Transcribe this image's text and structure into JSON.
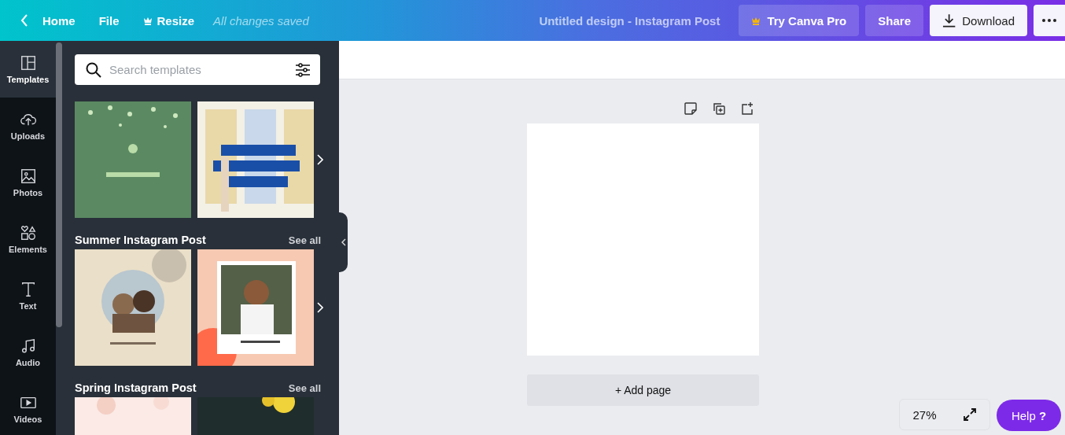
{
  "topbar": {
    "home": "Home",
    "file": "File",
    "resize": "Resize",
    "status": "All changes saved",
    "title": "Untitled design - Instagram Post",
    "try_pro": "Try Canva Pro",
    "share": "Share",
    "download": "Download"
  },
  "rail": [
    {
      "kind": "templates",
      "label": "Templates",
      "selected": true
    },
    {
      "kind": "uploads",
      "label": "Uploads",
      "selected": false
    },
    {
      "kind": "photos",
      "label": "Photos",
      "selected": false
    },
    {
      "kind": "elements",
      "label": "Elements",
      "selected": false
    },
    {
      "kind": "text",
      "label": "Text",
      "selected": false
    },
    {
      "kind": "audio",
      "label": "Audio",
      "selected": false
    },
    {
      "kind": "videos",
      "label": "Videos",
      "selected": false
    }
  ],
  "panel": {
    "search": {
      "placeholder": "Search templates"
    },
    "sections": [
      {
        "thumbnails": [
          {
            "kind": "picture"
          },
          {
            "kind": "picture"
          }
        ]
      },
      {
        "title": "Summer Instagram Post",
        "see_all": "See all",
        "thumbnails": [
          {
            "kind": "picture"
          },
          {
            "kind": "picture"
          }
        ]
      },
      {
        "title": "Spring Instagram Post",
        "see_all": "See all",
        "thumbnails": [
          {
            "kind": "picture"
          },
          {
            "kind": "picture"
          }
        ]
      }
    ]
  },
  "canvas": {
    "add_page": "+ Add page",
    "zoom": "27%",
    "help": "Help",
    "help_mark": "?"
  }
}
